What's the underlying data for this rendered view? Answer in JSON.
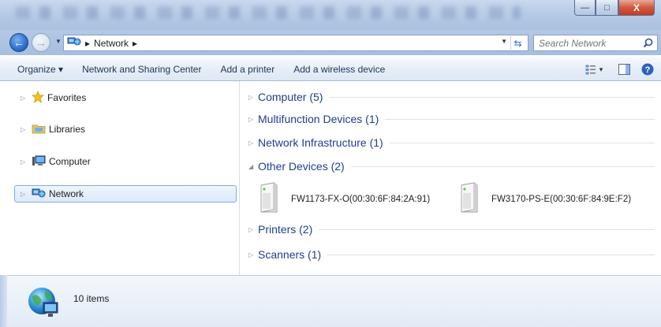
{
  "window": {
    "minimize_label": "—",
    "maximize_label": "□",
    "close_label": "X"
  },
  "address": {
    "breadcrumb_root_arrow": "▸",
    "breadcrumb": "Network",
    "breadcrumb_after": "▸",
    "search_placeholder": "Search Network"
  },
  "toolbar": {
    "organize": "Organize ▾",
    "network_sharing": "Network and Sharing Center",
    "add_printer": "Add a printer",
    "add_wireless": "Add a wireless device",
    "view_dropdown": "▾"
  },
  "sidebar": {
    "items": [
      {
        "label": "Favorites",
        "icon": "star-icon"
      },
      {
        "label": "Libraries",
        "icon": "libraries-icon"
      },
      {
        "label": "Computer",
        "icon": "computer-icon"
      },
      {
        "label": "Network",
        "icon": "network-icon",
        "selected": true
      }
    ]
  },
  "groups": [
    {
      "label": "Computer (5)",
      "expanded": false
    },
    {
      "label": "Multifunction Devices (1)",
      "expanded": false
    },
    {
      "label": "Network Infrastructure (1)",
      "expanded": false
    },
    {
      "label": "Other Devices (2)",
      "expanded": true
    },
    {
      "label": "Printers (2)",
      "expanded": false
    },
    {
      "label": "Scanners (1)",
      "expanded": false
    }
  ],
  "devices": [
    {
      "name": "FW1173-FX-O(00:30:6F:84:2A:91)"
    },
    {
      "name": "FW3170-PS-E(00:30:6F:84:9E:F2)"
    }
  ],
  "status": {
    "count": "10 items"
  },
  "colors": {
    "accent": "#1e3e8e",
    "selection_border": "#84acdd",
    "chrome": "#b5cbe6"
  }
}
